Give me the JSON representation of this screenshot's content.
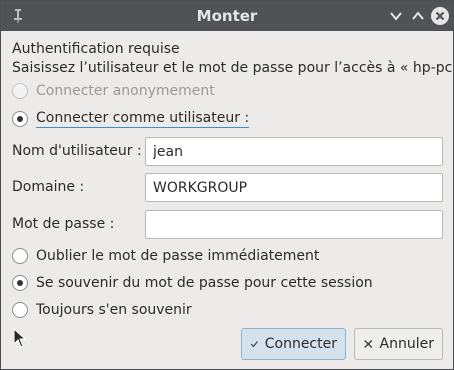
{
  "window": {
    "title": "Monter"
  },
  "auth": {
    "heading": "Authentification requise",
    "prompt": "Saisissez l’utilisateur et le mot de passe pour l’accès à « hp-pc » :"
  },
  "access_mode": {
    "anonymous_label": "Connecter anonymement",
    "as_user_label": "Connecter comme utilisateur :",
    "selected": "as_user",
    "anonymous_disabled": true
  },
  "fields": {
    "username_label": "Nom d'utilisateur :",
    "username_value": "jean",
    "domain_label": "Domaine :",
    "domain_value": "WORKGROUP",
    "password_label": "Mot de passe :",
    "password_value": ""
  },
  "remember": {
    "options": [
      "Oublier le mot de passe immédiatement",
      "Se souvenir du mot de passe pour cette session",
      "Toujours s'en souvenir"
    ],
    "selected_index": 1
  },
  "buttons": {
    "connect_label": "Connecter",
    "cancel_label": "Annuler"
  }
}
